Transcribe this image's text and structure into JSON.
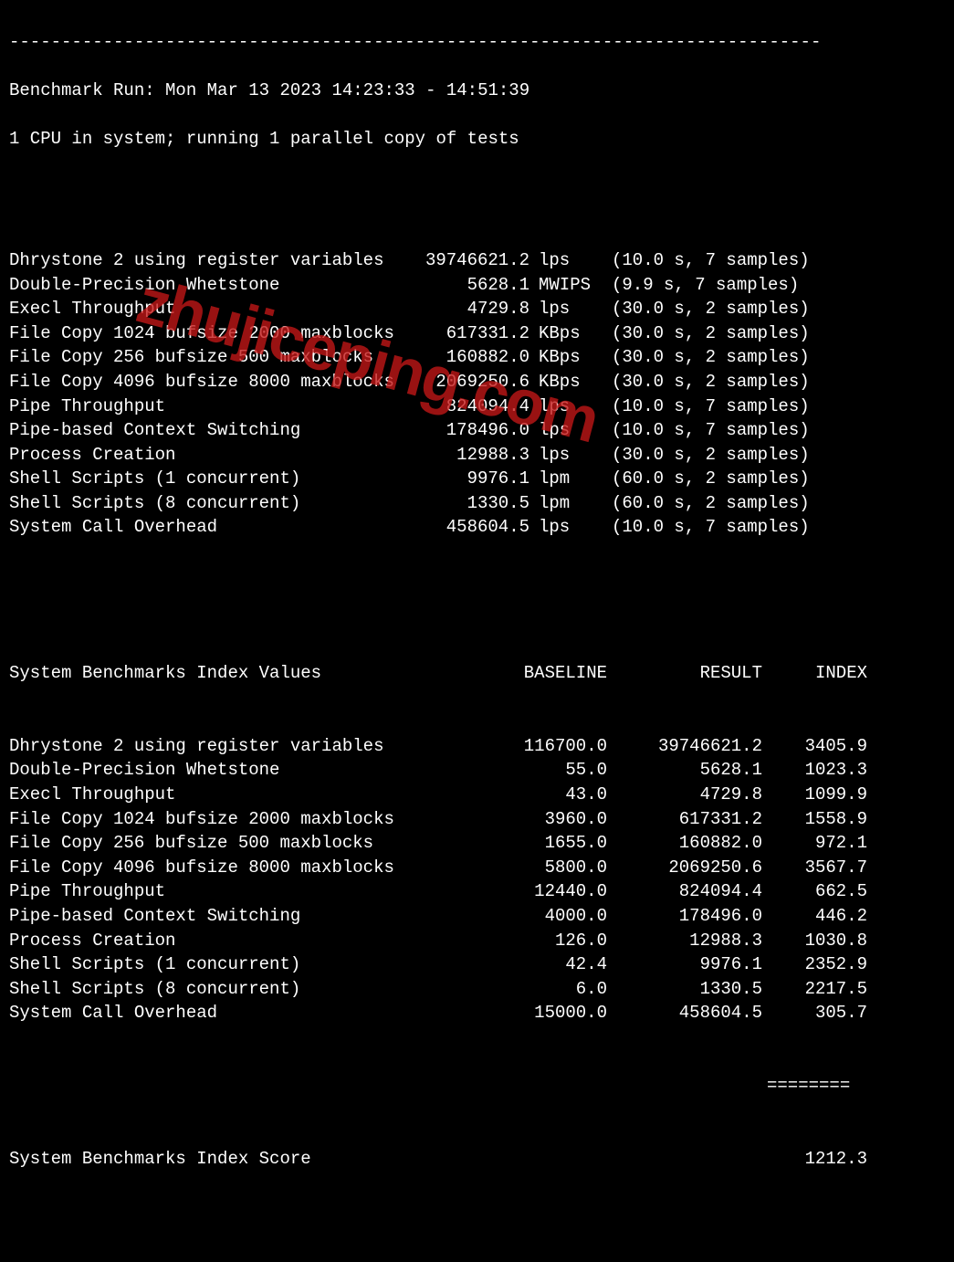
{
  "dashes": "------------------------------------------------------------------------------",
  "header": {
    "run_line": "Benchmark Run: Mon Mar 13 2023 14:23:33 - 14:51:39",
    "cpu_line": "1 CPU in system; running 1 parallel copy of tests"
  },
  "tests": [
    {
      "name": "Dhrystone 2 using register variables",
      "value": "39746621.2",
      "unit": "lps",
      "dur": "(10.0 s, 7 samples)"
    },
    {
      "name": "Double-Precision Whetstone",
      "value": "5628.1",
      "unit": "MWIPS",
      "dur": "(9.9 s, 7 samples)"
    },
    {
      "name": "Execl Throughput",
      "value": "4729.8",
      "unit": "lps",
      "dur": "(30.0 s, 2 samples)"
    },
    {
      "name": "File Copy 1024 bufsize 2000 maxblocks",
      "value": "617331.2",
      "unit": "KBps",
      "dur": "(30.0 s, 2 samples)"
    },
    {
      "name": "File Copy 256 bufsize 500 maxblocks",
      "value": "160882.0",
      "unit": "KBps",
      "dur": "(30.0 s, 2 samples)"
    },
    {
      "name": "File Copy 4096 bufsize 8000 maxblocks",
      "value": "2069250.6",
      "unit": "KBps",
      "dur": "(30.0 s, 2 samples)"
    },
    {
      "name": "Pipe Throughput",
      "value": "824094.4",
      "unit": "lps",
      "dur": "(10.0 s, 7 samples)"
    },
    {
      "name": "Pipe-based Context Switching",
      "value": "178496.0",
      "unit": "lps",
      "dur": "(10.0 s, 7 samples)"
    },
    {
      "name": "Process Creation",
      "value": "12988.3",
      "unit": "lps",
      "dur": "(30.0 s, 2 samples)"
    },
    {
      "name": "Shell Scripts (1 concurrent)",
      "value": "9976.1",
      "unit": "lpm",
      "dur": "(60.0 s, 2 samples)"
    },
    {
      "name": "Shell Scripts (8 concurrent)",
      "value": "1330.5",
      "unit": "lpm",
      "dur": "(60.0 s, 2 samples)"
    },
    {
      "name": "System Call Overhead",
      "value": "458604.5",
      "unit": "lps",
      "dur": "(10.0 s, 7 samples)"
    }
  ],
  "index_header": {
    "name": "System Benchmarks Index Values",
    "baseline": "BASELINE",
    "result": "RESULT",
    "index": "INDEX"
  },
  "index": [
    {
      "name": "Dhrystone 2 using register variables",
      "baseline": "116700.0",
      "result": "39746621.2",
      "index": "3405.9"
    },
    {
      "name": "Double-Precision Whetstone",
      "baseline": "55.0",
      "result": "5628.1",
      "index": "1023.3"
    },
    {
      "name": "Execl Throughput",
      "baseline": "43.0",
      "result": "4729.8",
      "index": "1099.9"
    },
    {
      "name": "File Copy 1024 bufsize 2000 maxblocks",
      "baseline": "3960.0",
      "result": "617331.2",
      "index": "1558.9"
    },
    {
      "name": "File Copy 256 bufsize 500 maxblocks",
      "baseline": "1655.0",
      "result": "160882.0",
      "index": "972.1"
    },
    {
      "name": "File Copy 4096 bufsize 8000 maxblocks",
      "baseline": "5800.0",
      "result": "2069250.6",
      "index": "3567.7"
    },
    {
      "name": "Pipe Throughput",
      "baseline": "12440.0",
      "result": "824094.4",
      "index": "662.5"
    },
    {
      "name": "Pipe-based Context Switching",
      "baseline": "4000.0",
      "result": "178496.0",
      "index": "446.2"
    },
    {
      "name": "Process Creation",
      "baseline": "126.0",
      "result": "12988.3",
      "index": "1030.8"
    },
    {
      "name": "Shell Scripts (1 concurrent)",
      "baseline": "42.4",
      "result": "9976.1",
      "index": "2352.9"
    },
    {
      "name": "Shell Scripts (8 concurrent)",
      "baseline": "6.0",
      "result": "1330.5",
      "index": "2217.5"
    },
    {
      "name": "System Call Overhead",
      "baseline": "15000.0",
      "result": "458604.5",
      "index": "305.7"
    }
  ],
  "eqline": "========",
  "score": {
    "name": "System Benchmarks Index Score",
    "value": "1212.3"
  },
  "watermark": "zhujiceping.com"
}
